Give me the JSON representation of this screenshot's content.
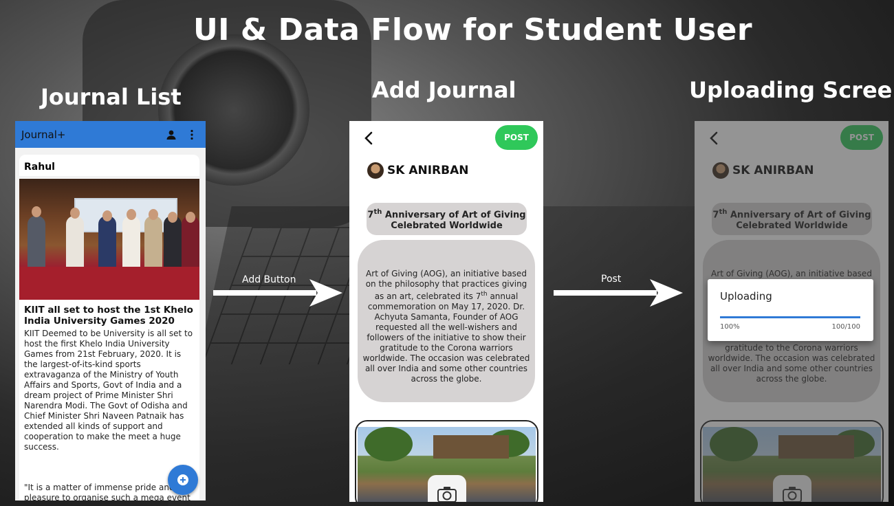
{
  "main_title": "UI & Data Flow for Student User",
  "sections": {
    "journal_list": "Journal List",
    "add_journal": "Add Journal",
    "uploading_screen": "Uploading Screen"
  },
  "arrows": {
    "first_label": "Add Button",
    "second_label": "Post"
  },
  "journal_list_screen": {
    "app_title": "Journal+",
    "icons": [
      "account-icon",
      "more-vert-icon",
      "add-icon"
    ],
    "card": {
      "author": "Rahul",
      "headline": "KIIT all set to host the 1st Khelo India University Games 2020",
      "body": "KIIT Deemed to be University is all set to host the first Khelo India University Games from 21st February, 2020. It is the largest-of-its-kind sports extravaganza of the Ministry of Youth Affairs and Sports, Govt of India and a dream project of Prime Minister Shri Narendra Modi. The Govt of Odisha and Chief Minister Shri Naveen Patnaik has extended all kinds of support and cooperation to make the meet a huge success.",
      "quote": "\"It is a matter of immense pride and pleasure to organise such a mega event at KIIT-DU in Bhubaneswar, Odisha. Hosting"
    }
  },
  "add_journal_screen": {
    "post_label": "POST",
    "user_name": "SK ANIRBAN",
    "title_sup": "th",
    "title_num": "7",
    "title_rest": "Anniversary of Art of Giving Celebrated Worldwide",
    "body_part1": "Art of Giving (AOG), an initiative based on the philosophy that practices giving as an art, celebrated its 7",
    "body_sup": "th",
    "body_part2": " annual commemoration on May 17, 2020. Dr. Achyuta Samanta, Founder of AOG requested all the well-wishers and followers of the initiative to show their gratitude to the Corona warriors worldwide. The occasion was celebrated all over India and some other countries across the globe.",
    "icons": [
      "back-arrow-icon",
      "camera-icon"
    ]
  },
  "uploading_screen_data": {
    "dialog_title": "Uploading",
    "progress_percent": "100%",
    "progress_count": "100/100",
    "progress_fraction": 1.0
  },
  "colors": {
    "app_bar": "#2f7ad6",
    "post_button": "#2fc85a",
    "pill_gray": "#d6d3d3"
  }
}
